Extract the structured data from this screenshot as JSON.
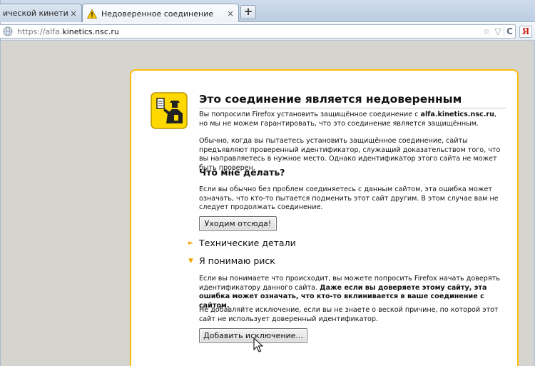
{
  "tabs": [
    {
      "label": "ической кинетики и...",
      "close": "×"
    },
    {
      "label": "Недоверенное соединение",
      "close": "×"
    }
  ],
  "new_tab": "+",
  "urlbar": {
    "prefix": "https://alfa.",
    "domain": "kinetics.nsc.ru",
    "star": "☆",
    "dropdown": "▽",
    "reload": "C"
  },
  "search_engine": "Я",
  "page": {
    "title": "Это соединение является недоверенным",
    "intro_prefix": "Вы попросили Firefox установить защищённое соединение с ",
    "intro_host": "alfa.kinetics.nsc.ru",
    "intro_suffix": ", но мы не можем гарантировать, что это соединение является защищённым.",
    "explain": "Обычно, когда вы пытаетесь установить защищённое соединение, сайты предъявляют проверенный идентификатор, служащий доказательством того, что вы направляетесь в нужное место. Однако идентификатор этого сайта не может быть проверен.",
    "what_to_do_heading": "Что мне делать?",
    "what_to_do_text": "Если вы обычно без проблем соединяетесь с данным сайтом, эта ошибка может означать, что кто-то пытается подменить этот сайт другим. В этом случае вам не следует продолжать соединение.",
    "get_me_out": "Уходим отсюда!",
    "technical_heading": "Технические детали",
    "risk_heading": "Я понимаю риск",
    "risk_text_1": "Если вы понимаете что происходит, вы можете попросить Firefox начать доверять идентификатору данного сайта. ",
    "risk_text_bold": "Даже если вы доверяете этому сайту, эта ошибка может означать, что кто-то вклинивается в ваше соединение с сайтом.",
    "risk_text_2": "Не добавляйте исключение, если вы не знаете о веской причине, по которой этот сайт не использует доверенный идентификатор.",
    "add_exception": "Добавить исключение...",
    "collapsed_arrow": "►",
    "expanded_arrow": "▼"
  },
  "colors": {
    "box_border": "#ffbd09",
    "arrow": "#f0a800"
  }
}
